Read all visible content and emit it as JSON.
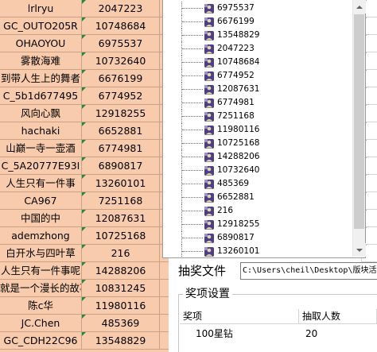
{
  "spreadsheet": {
    "rows": [
      {
        "name": "lrlryu",
        "id": "2047223"
      },
      {
        "name": "GC_OUTO205R",
        "id": "10748684"
      },
      {
        "name": "OHAOYOU",
        "id": "6975537"
      },
      {
        "name": "雾散海难",
        "id": "10732640"
      },
      {
        "name": "到带人生上的舞者",
        "id": "6676199"
      },
      {
        "name": "C_5b1d677495",
        "id": "6774952"
      },
      {
        "name": "风向心飘",
        "id": "12918255"
      },
      {
        "name": "hachaki",
        "id": "6652881"
      },
      {
        "name": "山巅一寺一壶酒",
        "id": "6774981"
      },
      {
        "name": "C_5A20777E93I",
        "id": "6890817"
      },
      {
        "name": "人生只有一件事",
        "id": "13260101"
      },
      {
        "name": "CA967",
        "id": "7251168"
      },
      {
        "name": "中国的中",
        "id": "12087631"
      },
      {
        "name": "ademzhong",
        "id": "10725168"
      },
      {
        "name": "白开水与四叶草",
        "id": "216"
      },
      {
        "name": "人生只有一件事呢",
        "id": "14288206"
      },
      {
        "name": "就是一个漫长的故事",
        "id": "10831245"
      },
      {
        "name": "陈c华",
        "id": "11980116"
      },
      {
        "name": "JC.Chen",
        "id": "485369"
      },
      {
        "name": "GC_CDH22C96",
        "id": "13548829"
      }
    ]
  },
  "tree": {
    "items": [
      "6975537",
      "6676199",
      "13548829",
      "2047223",
      "10748684",
      "6774952",
      "12087631",
      "6774981",
      "7251168",
      "11980116",
      "10725168",
      "14288206",
      "10732640",
      "485369",
      "6652881",
      "216",
      "12918255",
      "6890817",
      "13260101",
      "10831245"
    ],
    "icon": "user-node-icon"
  },
  "lottery_file": {
    "label": "抽奖文件",
    "path": "C:\\Users\\cheil\\Desktop\\版块活动"
  },
  "prize_settings": {
    "title": "奖项设置",
    "headers": {
      "prize": "奖项",
      "count": "抽取人数"
    },
    "rows": [
      {
        "prize": "100星钻",
        "count": "20"
      }
    ]
  },
  "colors": {
    "sheet_fill": "#f8cbad",
    "comment_marker": "#1f8a3c",
    "tree_icon": "#4b3f8a"
  }
}
